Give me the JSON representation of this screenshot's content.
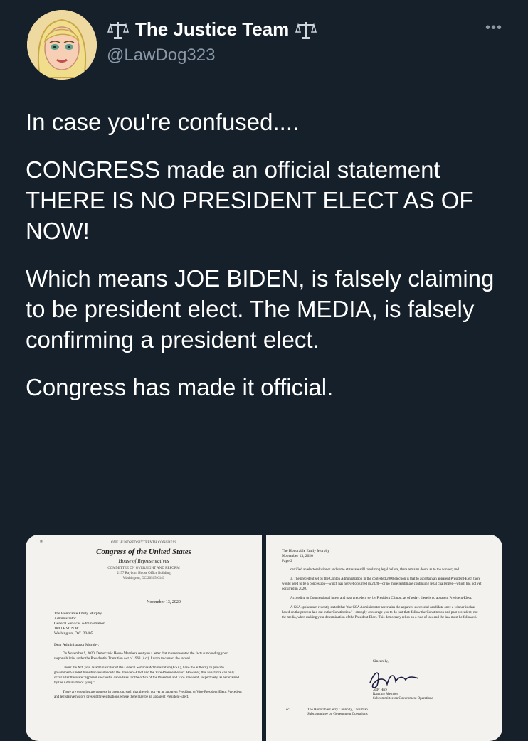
{
  "header": {
    "display_name": "The Justice Team",
    "handle": "@LawDog323",
    "more": "•••",
    "icons": [
      "scale-icon",
      "scale-icon"
    ]
  },
  "tweet": {
    "paragraphs": [
      "In case you're confused....",
      "CONGRESS made an official statement THERE IS NO PRESIDENT ELECT AS OF NOW!",
      "Which means JOE BIDEN, is falsely claiming to be president elect. The MEDIA, is falsely confirming a president elect.",
      "Congress has made it official."
    ]
  },
  "media": {
    "page1": {
      "top_line": "ONE HUNDRED SIXTEENTH CONGRESS",
      "title": "Congress of the United States",
      "subtitle": "House of Representatives",
      "committee": "COMMITTEE ON OVERSIGHT AND REFORM",
      "address_line": "2157 Rayburn House Office Building",
      "city_line": "Washington, DC 20515-6143",
      "date": "November 13, 2020",
      "recipient": [
        "The Honorable Emily Murphy",
        "Administrator",
        "General Services Administration",
        "1800 F St. N.W.",
        "Washington, D.C. 20405"
      ],
      "salutation": "Dear Administrator Murphy:",
      "body": [
        "On November 9, 2020, Democratic House Members sent you a letter that misrepresented the facts surrounding your responsibilities under the Presidential Transition Act of 1963 (Act). I write to correct the record.",
        "Under the Act, you, as administrator of the General Services Administration (GSA), have the authority to provide government-funded transition assistance to the President-Elect and the Vice-President-Elect. However, this assistance can only occur after there are \"apparent successful candidates for the office of the President and Vice President, respectively, as ascertained by the Administrator [you].\"",
        "There are enough state contests in question, such that there is not yet an apparent President or Vice-President-Elect. Precedent and legislative history present three situations where there may be an apparent President-Elect."
      ]
    },
    "page2": {
      "top": [
        "The Honorable Emily Murphy",
        "November 13, 2020",
        "Page 2"
      ],
      "body": [
        "certified an electoral winner and some states are still tabulating legal ballots, there remains doubt as to the winner; and",
        "3. The precedent set by the Clinton Administration in the contested 2000 election is that to ascertain an apparent President-Elect there would need to be a concession—which has not yet occurred in 2020—or no more legitimate continuing legal challenges—which has not yet occurred in 2020.",
        "According to Congressional intent and past precedent set by President Clinton, as of today, there is no apparent President-Elect.",
        "A GSA spokesman recently stated that \"the GSA Administrator ascertains the apparent successful candidate once a winner is clear based on the process laid out in the Constitution.\" I strongly encourage you to do just that: follow the Constitution and past precedent, not the media, when making your determination of the President-Elect. This democracy relies on a rule of law and the law must be followed."
      ],
      "closing": "Sincerely,",
      "signer": [
        "Jody Hice",
        "Ranking Member",
        "Subcommittee on Government Operations"
      ],
      "cc_label": "cc:",
      "cc": [
        "The Honorable Gerry Connolly, Chairman",
        "Subcommittee on Government Operations"
      ]
    }
  },
  "colors": {
    "background": "#15202b",
    "text": "#ffffff",
    "muted": "#8b98a5",
    "paper": "#f3f2ee"
  }
}
